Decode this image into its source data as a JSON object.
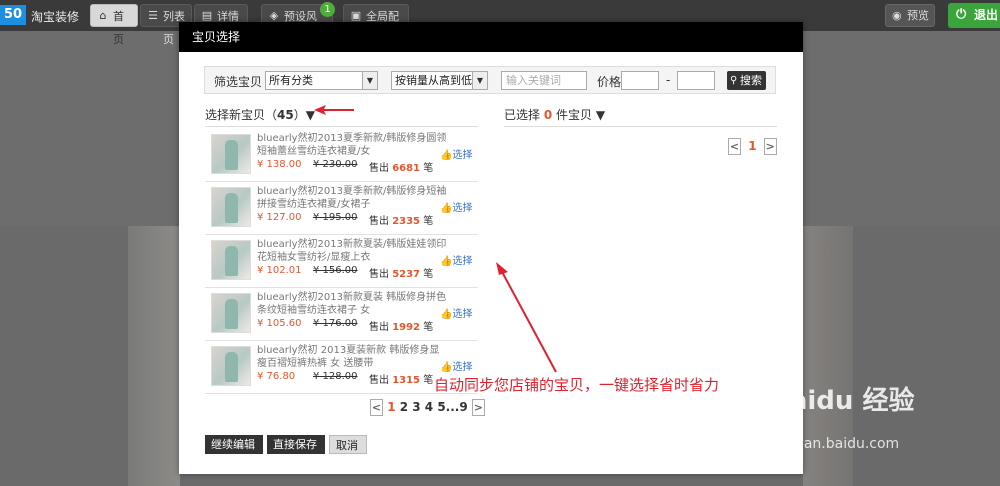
{
  "app": {
    "logo_text": "50",
    "brand": "淘宝装修"
  },
  "nav": [
    {
      "label": "首页",
      "icon": "home-icon",
      "glyph": "⌂"
    },
    {
      "label": "列表页",
      "icon": "list-icon",
      "glyph": "☰"
    },
    {
      "label": "详情页",
      "icon": "detail-icon",
      "glyph": "▤"
    },
    {
      "label": "预设风格",
      "icon": "palette-icon",
      "glyph": "◈",
      "badge": "1"
    },
    {
      "label": "全局配置",
      "icon": "config-icon",
      "glyph": "▣"
    }
  ],
  "topright": {
    "preview": "预览",
    "exit": "退出"
  },
  "dialog": {
    "title": "宝贝选择",
    "filter": {
      "label": "筛选宝贝",
      "category": "所有分类",
      "sort": "按销量从高到低",
      "keyword_placeholder": "输入关键词",
      "price_label": "价格",
      "dash": "-",
      "search": "搜索"
    },
    "left": {
      "prefix": "选择新宝贝（",
      "count": "45",
      "suffix": "）▼"
    },
    "right": {
      "prefix": "已选择 ",
      "count": "0",
      "suffix": " 件宝贝 ▼"
    },
    "items": [
      {
        "name": "bluearly然初2013夏季新款/韩版修身圆领短袖蕾丝雪纺连衣裙夏/女",
        "price": "¥ 138.00",
        "old": "¥ 230.00",
        "sold_label": "售出",
        "sold": "6681",
        "unit": "笔",
        "choose": "选择"
      },
      {
        "name": "bluearly然初2013夏季新款/韩版修身短袖拼接雪纺连衣裙夏/女裙子",
        "price": "¥ 127.00",
        "old": "¥ 195.00",
        "sold_label": "售出",
        "sold": "2335",
        "unit": "笔",
        "choose": "选择"
      },
      {
        "name": "bluearly然初2013新款夏装/韩版娃娃领印花短袖女雪纺衫/显瘦上衣",
        "price": "¥ 102.01",
        "old": "¥ 156.00",
        "sold_label": "售出",
        "sold": "5237",
        "unit": "笔",
        "choose": "选择"
      },
      {
        "name": "bluearly然初2013新款夏装 韩版修身拼色条纹短袖雪纺连衣裙子 女",
        "price": "¥ 105.60",
        "old": "¥ 176.00",
        "sold_label": "售出",
        "sold": "1992",
        "unit": "笔",
        "choose": "选择"
      },
      {
        "name": "bluearly然初 2013夏装新款 韩版修身显瘦百褶短裤热裤 女 送腰带",
        "price": "¥ 76.80",
        "old": "¥ 128.00",
        "sold_label": "售出",
        "sold": "1315",
        "unit": "笔",
        "choose": "选择"
      }
    ],
    "pager": {
      "prev": "<",
      "current": "1",
      "pages": "2 3 4 5",
      "ellipsis": "...",
      "last": "9",
      "next": ">"
    },
    "right_pager": {
      "prev": "<",
      "current": "1",
      "next": ">"
    },
    "actions": {
      "continue": "继续编辑",
      "save": "直接保存",
      "cancel": "取消"
    }
  },
  "annotation": "自动同步您店铺的宝贝，一键选择省时省力",
  "watermark": {
    "main": "Baidu 经验",
    "sub": "jingyan.baidu.com"
  },
  "colors": {
    "accent": "#e4572e",
    "link": "#3a73c6",
    "annot": "#e0212e",
    "exit": "#3aa53a"
  }
}
